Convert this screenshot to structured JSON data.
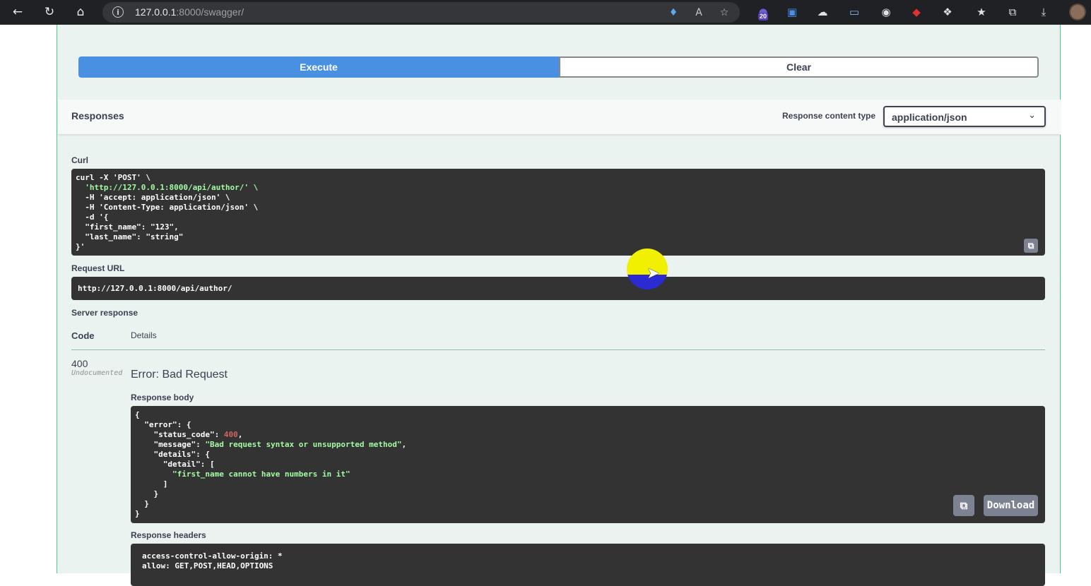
{
  "browser": {
    "url_host": "127.0.0.1",
    "url_rest": ":8000/swagger/",
    "extension_badge": "20",
    "icons": [
      "back-icon",
      "reload-icon",
      "home-icon",
      "info-icon",
      "tag-icon",
      "read-aloud-icon",
      "favorite-add-icon",
      "extension-icon",
      "translate-icon",
      "cloud-icon",
      "cast-icon",
      "globe-icon",
      "red-extension-icon",
      "puzzle-icon",
      "favorites-icon",
      "collections-icon",
      "download-icon",
      "avatar"
    ]
  },
  "actions": {
    "execute_label": "Execute",
    "clear_label": "Clear"
  },
  "responses": {
    "title": "Responses",
    "content_type_label": "Response content type",
    "content_type_value": "application/json"
  },
  "curl": {
    "label": "Curl",
    "lines": [
      "curl -X 'POST' \\",
      "  'http://127.0.0.1:8000/api/author/' \\",
      "  -H 'accept: application/json' \\",
      "  -H 'Content-Type: application/json' \\",
      "  -d '{",
      "  \"first_name\": \"123\",",
      "  \"last_name\": \"string\"",
      "}'"
    ]
  },
  "request_url": {
    "label": "Request URL",
    "value": "http://127.0.0.1:8000/api/author/"
  },
  "server_response": {
    "label": "Server response",
    "code_header": "Code",
    "details_header": "Details",
    "status_code": "400",
    "undocumented": "Undocumented",
    "error_title": "Error: Bad Request",
    "body_label": "Response body",
    "body": {
      "status_code": "400",
      "message": "Bad request syntax or unsupported method",
      "detail_item": "first_name cannot have numbers in it"
    },
    "download_label": "Download",
    "headers_label": "Response headers",
    "headers": [
      "access-control-allow-origin: *",
      "allow: GET,POST,HEAD,OPTIONS"
    ]
  }
}
